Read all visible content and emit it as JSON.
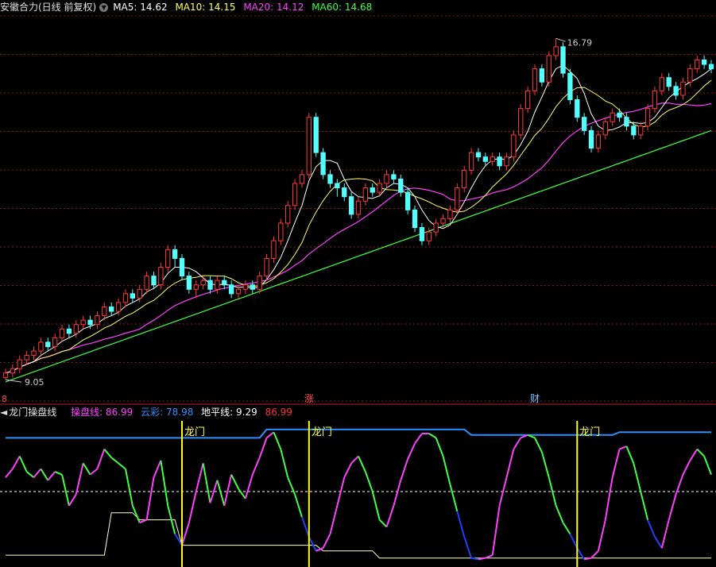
{
  "top_header": {
    "title": "安徽合力(日线 前复权)",
    "ma5_label": "MA5: 14.62",
    "ma10_label": "MA10: 14.15",
    "ma20_label": "MA20: 14.12",
    "ma60_label": "MA60: 14.68"
  },
  "bottom_header": {
    "title": "龙门操盘线",
    "caopan_label": "操盘线: 86.99",
    "yuncai_label": "云彩: 78.98",
    "dipingxian_label": "地平线: 9.29",
    "extra_value": "86.99"
  },
  "markers": {
    "zhang": "涨",
    "cai": "财",
    "longmen": "龙门",
    "left_edge": "8"
  },
  "colors": {
    "up_candle": "#ff3a3a",
    "down_candle": "#54ffff",
    "ma5": "#ffffff",
    "ma10": "#ffff60",
    "ma20": "#ff40ff",
    "ma60": "#40ff40",
    "yuncai": "#2f8fff",
    "longmen_line": "#ffff00",
    "grid": "#8a1a1a"
  },
  "chart_data": [
    {
      "type": "candlestick",
      "title": "安徽合力(日线 前复权)",
      "high_label": "16.79",
      "low_label": "9.05",
      "ylim": [
        8.8,
        17.3
      ],
      "candles": [
        [
          9.1,
          9.2,
          9.3,
          9.05
        ],
        [
          9.2,
          9.3,
          9.4,
          9.1
        ],
        [
          9.3,
          9.5,
          9.6,
          9.2
        ],
        [
          9.5,
          9.6,
          9.7,
          9.4
        ],
        [
          9.6,
          9.7,
          9.8,
          9.5
        ],
        [
          9.7,
          9.9,
          10.0,
          9.6
        ],
        [
          9.9,
          9.8,
          10.0,
          9.7
        ],
        [
          9.8,
          10.0,
          10.1,
          9.7
        ],
        [
          10.0,
          10.2,
          10.3,
          9.9
        ],
        [
          10.2,
          10.1,
          10.3,
          10.0
        ],
        [
          10.1,
          10.3,
          10.4,
          10.0
        ],
        [
          10.3,
          10.4,
          10.5,
          10.2
        ],
        [
          10.4,
          10.3,
          10.5,
          10.2
        ],
        [
          10.3,
          10.5,
          10.6,
          10.2
        ],
        [
          10.5,
          10.7,
          10.8,
          10.4
        ],
        [
          10.7,
          10.6,
          10.8,
          10.5
        ],
        [
          10.6,
          10.8,
          10.9,
          10.5
        ],
        [
          10.8,
          11.0,
          11.1,
          10.7
        ],
        [
          11.0,
          10.9,
          11.1,
          10.8
        ],
        [
          10.9,
          11.1,
          11.2,
          10.8
        ],
        [
          11.1,
          11.4,
          11.5,
          11.0
        ],
        [
          11.4,
          11.2,
          11.5,
          11.1
        ],
        [
          11.2,
          11.6,
          11.7,
          11.1
        ],
        [
          11.6,
          12.0,
          12.1,
          11.5
        ],
        [
          12.0,
          11.8,
          12.1,
          11.6
        ],
        [
          11.8,
          11.4,
          11.9,
          11.3
        ],
        [
          11.4,
          11.1,
          11.5,
          11.0
        ],
        [
          11.1,
          11.2,
          11.3,
          10.9
        ],
        [
          11.2,
          11.3,
          11.4,
          11.1
        ],
        [
          11.3,
          11.1,
          11.4,
          11.0
        ],
        [
          11.1,
          11.3,
          11.4,
          11.0
        ],
        [
          11.3,
          11.2,
          11.4,
          11.1
        ],
        [
          11.2,
          11.0,
          11.3,
          10.9
        ],
        [
          11.0,
          11.1,
          11.2,
          10.9
        ],
        [
          11.1,
          11.2,
          11.3,
          11.0
        ],
        [
          11.2,
          11.1,
          11.3,
          11.0
        ],
        [
          11.1,
          11.4,
          11.5,
          11.0
        ],
        [
          11.4,
          11.8,
          11.9,
          11.3
        ],
        [
          11.8,
          12.2,
          12.3,
          11.7
        ],
        [
          12.2,
          12.6,
          12.7,
          12.1
        ],
        [
          12.6,
          13.0,
          13.1,
          12.5
        ],
        [
          13.0,
          13.5,
          13.6,
          12.9
        ],
        [
          13.5,
          13.7,
          13.8,
          13.4
        ],
        [
          13.7,
          15.0,
          15.1,
          13.6
        ],
        [
          15.0,
          14.2,
          15.1,
          14.1
        ],
        [
          14.2,
          13.7,
          14.3,
          13.6
        ],
        [
          13.7,
          13.5,
          13.8,
          13.4
        ],
        [
          13.5,
          13.4,
          13.6,
          13.2
        ],
        [
          13.4,
          13.2,
          13.5,
          13.1
        ],
        [
          13.2,
          12.8,
          13.3,
          12.7
        ],
        [
          12.8,
          13.1,
          13.2,
          12.7
        ],
        [
          13.1,
          13.4,
          13.5,
          13.0
        ],
        [
          13.4,
          13.3,
          13.5,
          13.2
        ],
        [
          13.3,
          13.5,
          13.6,
          13.2
        ],
        [
          13.5,
          13.7,
          13.8,
          13.4
        ],
        [
          13.7,
          13.6,
          13.8,
          13.5
        ],
        [
          13.6,
          13.3,
          13.7,
          13.2
        ],
        [
          13.3,
          12.9,
          13.4,
          12.8
        ],
        [
          12.9,
          12.5,
          13.0,
          12.4
        ],
        [
          12.5,
          12.2,
          12.6,
          12.1
        ],
        [
          12.2,
          12.4,
          12.5,
          12.1
        ],
        [
          12.4,
          12.6,
          12.7,
          12.3
        ],
        [
          12.6,
          12.7,
          12.8,
          12.5
        ],
        [
          12.7,
          12.9,
          13.0,
          12.6
        ],
        [
          12.9,
          13.4,
          13.5,
          12.8
        ],
        [
          13.4,
          13.8,
          13.9,
          13.3
        ],
        [
          13.8,
          14.2,
          14.3,
          13.7
        ],
        [
          14.2,
          14.1,
          14.3,
          14.0
        ],
        [
          14.1,
          14.0,
          14.2,
          13.9
        ],
        [
          14.0,
          14.1,
          14.2,
          13.9
        ],
        [
          14.1,
          13.9,
          14.2,
          13.8
        ],
        [
          13.9,
          14.1,
          14.2,
          13.8
        ],
        [
          14.1,
          14.6,
          14.7,
          14.0
        ],
        [
          14.6,
          15.2,
          15.3,
          14.5
        ],
        [
          15.2,
          15.6,
          15.7,
          15.1
        ],
        [
          15.6,
          16.1,
          16.2,
          15.5
        ],
        [
          16.1,
          15.8,
          16.2,
          15.7
        ],
        [
          15.8,
          16.4,
          16.5,
          15.7
        ],
        [
          16.4,
          16.6,
          16.79,
          16.3
        ],
        [
          16.6,
          16.0,
          16.7,
          15.9
        ],
        [
          16.0,
          15.4,
          16.1,
          15.3
        ],
        [
          15.4,
          15.0,
          15.5,
          14.9
        ],
        [
          15.0,
          14.7,
          15.1,
          14.6
        ],
        [
          14.7,
          14.3,
          14.8,
          14.2
        ],
        [
          14.3,
          14.6,
          14.7,
          14.2
        ],
        [
          14.6,
          14.9,
          15.0,
          14.5
        ],
        [
          14.9,
          15.1,
          15.2,
          14.8
        ],
        [
          15.1,
          15.0,
          15.2,
          14.9
        ],
        [
          15.0,
          14.8,
          15.1,
          14.7
        ],
        [
          14.8,
          14.6,
          14.9,
          14.5
        ],
        [
          14.6,
          14.8,
          14.9,
          14.5
        ],
        [
          14.8,
          15.2,
          15.3,
          14.7
        ],
        [
          15.2,
          15.6,
          15.7,
          15.1
        ],
        [
          15.6,
          15.9,
          16.0,
          15.5
        ],
        [
          15.9,
          15.7,
          16.0,
          15.6
        ],
        [
          15.7,
          15.5,
          15.8,
          15.4
        ],
        [
          15.5,
          15.8,
          15.9,
          15.4
        ],
        [
          15.8,
          16.1,
          16.2,
          15.7
        ],
        [
          16.1,
          16.3,
          16.4,
          16.0
        ],
        [
          16.3,
          16.2,
          16.4,
          16.1
        ],
        [
          16.2,
          16.1,
          16.3,
          16.0
        ]
      ],
      "moving_averages": [
        {
          "name": "MA5",
          "value": 14.62
        },
        {
          "name": "MA10",
          "value": 14.15
        },
        {
          "name": "MA20",
          "value": 14.12
        },
        {
          "name": "MA60",
          "value": 14.68
        }
      ],
      "grid": true
    },
    {
      "type": "line",
      "title": "龙门操盘线",
      "ylim": [
        0,
        100
      ],
      "series": [
        {
          "name": "操盘线",
          "color": "#ff40ff",
          "values": [
            60,
            66,
            75,
            64,
            60,
            66,
            58,
            64,
            62,
            40,
            48,
            70,
            62,
            66,
            80,
            74,
            70,
            66,
            40,
            28,
            30,
            60,
            72,
            40,
            20,
            12,
            28,
            50,
            70,
            42,
            58,
            40,
            62,
            52,
            45,
            62,
            74,
            88,
            92,
            80,
            60,
            48,
            32,
            18,
            8,
            10,
            20,
            40,
            60,
            70,
            75,
            64,
            50,
            30,
            25,
            40,
            58,
            73,
            84,
            91,
            91,
            88,
            75,
            55,
            36,
            18,
            3,
            2,
            3,
            5,
            40,
            60,
            80,
            88,
            90,
            88,
            78,
            60,
            40,
            28,
            20,
            10,
            2,
            3,
            8,
            30,
            60,
            80,
            82,
            70,
            50,
            30,
            18,
            10,
            30,
            48,
            62,
            72,
            80,
            75,
            62
          ]
        },
        {
          "name": "云彩",
          "color": "#2f8fff",
          "values": [
            88,
            88,
            88,
            88,
            88,
            88,
            88,
            88,
            88,
            88,
            88,
            88,
            88,
            88,
            88,
            88,
            88,
            88,
            88,
            88,
            88,
            88,
            88,
            88,
            88,
            88,
            88,
            88,
            88,
            88,
            88,
            88,
            88,
            88,
            88,
            88,
            88,
            94,
            94,
            94,
            94,
            94,
            94,
            94,
            94,
            94,
            94,
            94,
            94,
            94,
            94,
            94,
            94,
            94,
            94,
            94,
            94,
            94,
            94,
            94,
            94,
            94,
            94,
            94,
            94,
            94,
            90,
            90,
            90,
            90,
            90,
            90,
            90,
            90,
            90,
            90,
            90,
            90,
            90,
            90,
            90,
            90,
            90,
            90,
            90,
            90,
            90,
            92,
            92,
            92,
            92,
            92,
            92,
            92,
            92,
            92,
            92,
            92,
            92,
            92,
            92
          ]
        },
        {
          "name": "地平线",
          "color": "#ffffcc",
          "values": [
            5,
            5,
            5,
            5,
            5,
            5,
            5,
            5,
            5,
            5,
            5,
            5,
            5,
            5,
            5,
            35,
            35,
            35,
            35,
            30,
            30,
            30,
            30,
            30,
            30,
            12,
            12,
            12,
            12,
            12,
            12,
            12,
            12,
            12,
            12,
            12,
            12,
            12,
            12,
            12,
            12,
            12,
            12,
            12,
            12,
            8,
            8,
            8,
            8,
            8,
            8,
            8,
            8,
            3,
            3,
            3,
            3,
            3,
            3,
            3,
            3,
            3,
            3,
            3,
            3,
            3,
            3,
            3,
            3,
            3,
            3,
            3,
            3,
            3,
            3,
            3,
            3,
            3,
            3,
            3,
            3,
            3,
            3,
            3,
            3,
            3,
            3,
            3,
            3,
            3,
            3,
            3,
            3,
            3,
            3,
            3,
            3,
            3,
            3,
            3,
            3
          ]
        }
      ],
      "longmen_signals": [
        25,
        43,
        81
      ],
      "reference_level": 50
    }
  ]
}
